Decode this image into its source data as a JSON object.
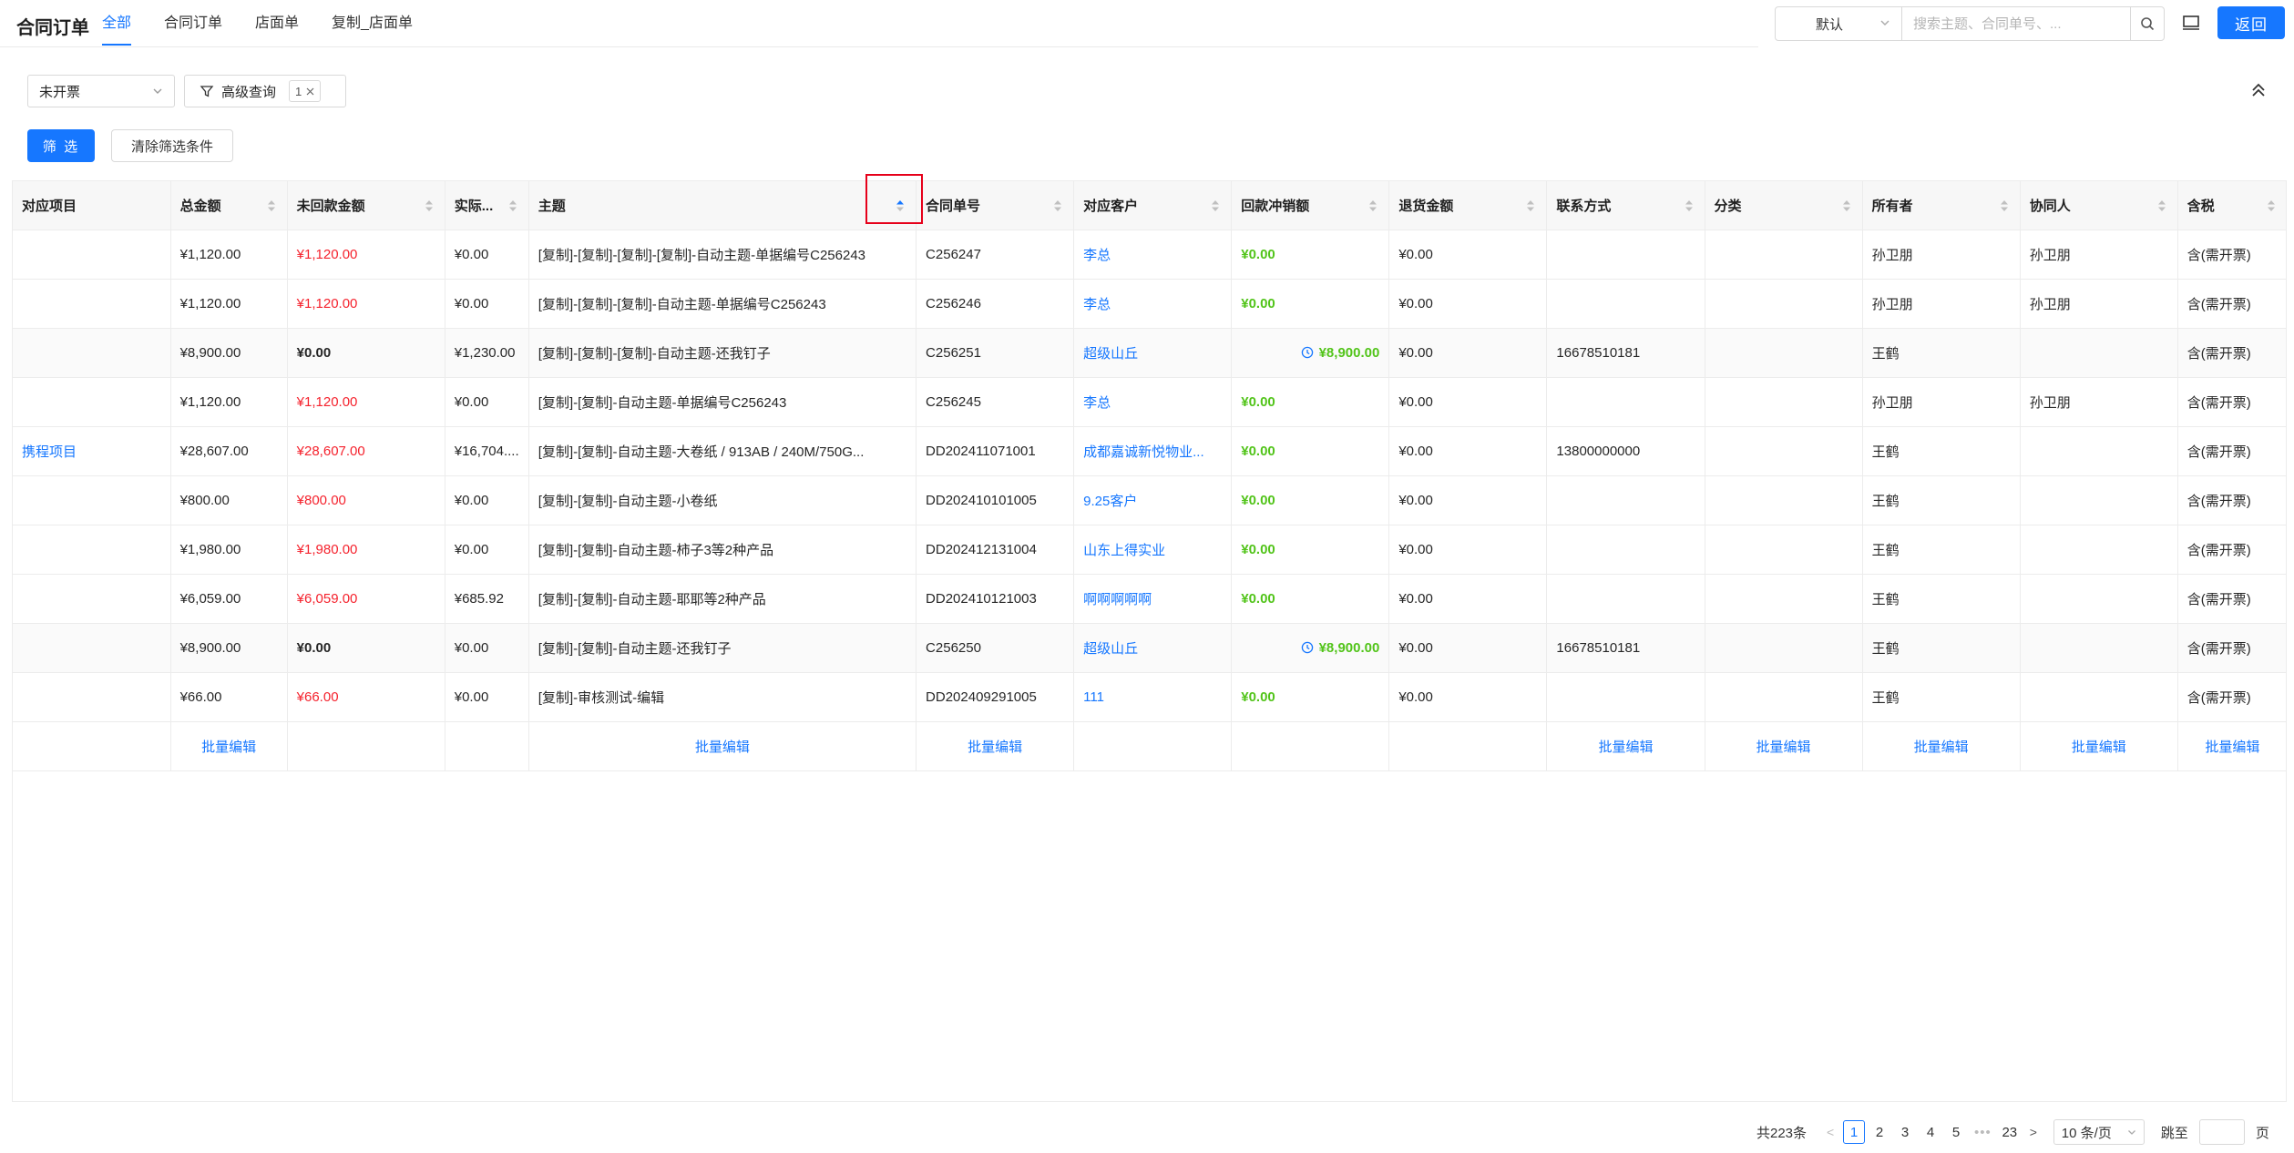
{
  "header": {
    "title": "合同订单",
    "tabs": [
      {
        "label": "全部",
        "active": true
      },
      {
        "label": "合同订单",
        "active": false
      },
      {
        "label": "店面单",
        "active": false
      },
      {
        "label": "复制_店面单",
        "active": false
      }
    ],
    "search_scope": "默认",
    "search_placeholder": "搜索主题、合同单号、...",
    "back_label": "返回"
  },
  "filters": {
    "invoice_status": "未开票",
    "advanced_query_label": "高级查询",
    "advanced_query_count": "1",
    "filter_button": "筛 选",
    "clear_button": "清除筛选条件"
  },
  "table": {
    "columns": [
      "对应项目",
      "总金额",
      "未回款金额",
      "实际...",
      "主题",
      "合同单号",
      "对应客户",
      "回款冲销额",
      "退货金额",
      "联系方式",
      "分类",
      "所有者",
      "协同人",
      "含税"
    ],
    "rows": [
      {
        "project": "",
        "total": "¥1,120.00",
        "unpaid": "¥1,120.00",
        "actual": "¥0.00",
        "subject": "[复制]-[复制]-[复制]-[复制]-自动主题-单据编号C256243",
        "contract_no": "C256247",
        "customer": "李总",
        "refund": "¥0.00",
        "return_amount": "¥0.00",
        "contact": "",
        "category": "",
        "owner": "孙卫朋",
        "collaborator": "孙卫朋",
        "tax": "含(需开票)"
      },
      {
        "project": "",
        "total": "¥1,120.00",
        "unpaid": "¥1,120.00",
        "actual": "¥0.00",
        "subject": "[复制]-[复制]-[复制]-自动主题-单据编号C256243",
        "contract_no": "C256246",
        "customer": "李总",
        "refund": "¥0.00",
        "return_amount": "¥0.00",
        "contact": "",
        "category": "",
        "owner": "孙卫朋",
        "collaborator": "孙卫朋",
        "tax": "含(需开票)"
      },
      {
        "project": "",
        "total": "¥8,900.00",
        "unpaid": "¥0.00",
        "actual": "¥1,230.00",
        "subject": "[复制]-[复制]-[复制]-自动主题-还我钉子",
        "contract_no": "C256251",
        "customer": "超级山丘",
        "refund": "¥8,900.00",
        "return_amount": "¥0.00",
        "contact": "16678510181",
        "category": "",
        "owner": "王鹤",
        "collaborator": "",
        "tax": "含(需开票)"
      },
      {
        "project": "",
        "total": "¥1,120.00",
        "unpaid": "¥1,120.00",
        "actual": "¥0.00",
        "subject": "[复制]-[复制]-自动主题-单据编号C256243",
        "contract_no": "C256245",
        "customer": "李总",
        "refund": "¥0.00",
        "return_amount": "¥0.00",
        "contact": "",
        "category": "",
        "owner": "孙卫朋",
        "collaborator": "孙卫朋",
        "tax": "含(需开票)"
      },
      {
        "project": "携程项目",
        "total": "¥28,607.00",
        "unpaid": "¥28,607.00",
        "actual": "¥16,704....",
        "subject": "[复制]-[复制]-自动主题-大卷纸 / 913AB / 240M/750G...",
        "contract_no": "DD202411071001",
        "customer": "成都嘉诚新悦物业...",
        "refund": "¥0.00",
        "return_amount": "¥0.00",
        "contact": "13800000000",
        "category": "",
        "owner": "王鹤",
        "collaborator": "",
        "tax": "含(需开票)"
      },
      {
        "project": "",
        "total": "¥800.00",
        "unpaid": "¥800.00",
        "actual": "¥0.00",
        "subject": "[复制]-[复制]-自动主题-小卷纸",
        "contract_no": "DD202410101005",
        "customer": "9.25客户",
        "refund": "¥0.00",
        "return_amount": "¥0.00",
        "contact": "",
        "category": "",
        "owner": "王鹤",
        "collaborator": "",
        "tax": "含(需开票)"
      },
      {
        "project": "",
        "total": "¥1,980.00",
        "unpaid": "¥1,980.00",
        "actual": "¥0.00",
        "subject": "[复制]-[复制]-自动主题-柿子3等2种产品",
        "contract_no": "DD202412131004",
        "customer": "山东上得实业",
        "refund": "¥0.00",
        "return_amount": "¥0.00",
        "contact": "",
        "category": "",
        "owner": "王鹤",
        "collaborator": "",
        "tax": "含(需开票)"
      },
      {
        "project": "",
        "total": "¥6,059.00",
        "unpaid": "¥6,059.00",
        "actual": "¥685.92",
        "subject": "[复制]-[复制]-自动主题-耶耶等2种产品",
        "contract_no": "DD202410121003",
        "customer": "啊啊啊啊啊",
        "refund": "¥0.00",
        "return_amount": "¥0.00",
        "contact": "",
        "category": "",
        "owner": "王鹤",
        "collaborator": "",
        "tax": "含(需开票)"
      },
      {
        "project": "",
        "total": "¥8,900.00",
        "unpaid": "¥0.00",
        "actual": "¥0.00",
        "subject": "[复制]-[复制]-自动主题-还我钉子",
        "contract_no": "C256250",
        "customer": "超级山丘",
        "refund": "¥8,900.00",
        "return_amount": "¥0.00",
        "contact": "16678510181",
        "category": "",
        "owner": "王鹤",
        "collaborator": "",
        "tax": "含(需开票)"
      },
      {
        "project": "",
        "total": "¥66.00",
        "unpaid": "¥66.00",
        "actual": "¥0.00",
        "subject": "[复制]-审核测试-编辑",
        "contract_no": "DD202409291005",
        "customer": "111",
        "refund": "¥0.00",
        "return_amount": "¥0.00",
        "contact": "",
        "category": "",
        "owner": "王鹤",
        "collaborator": "",
        "tax": "含(需开票)"
      }
    ],
    "batch_edit_label": "批量编辑"
  },
  "pagination": {
    "total": "共223条",
    "pages": [
      "1",
      "2",
      "3",
      "4",
      "5"
    ],
    "last_page": "23",
    "current": "1",
    "page_size": "10 条/页",
    "jump_label": "跳至",
    "page_suffix": "页"
  },
  "colors": {
    "primary": "#1677ff",
    "unpaid_red": "#f5222d",
    "refund_green": "#52c41a",
    "highlight_box": "#e6001a"
  },
  "icons": [
    "search-icon",
    "monitor-icon",
    "filter-icon",
    "close-icon",
    "chevron-down-icon",
    "chevron-up-double-icon",
    "sort-icon",
    "clock-icon"
  ]
}
